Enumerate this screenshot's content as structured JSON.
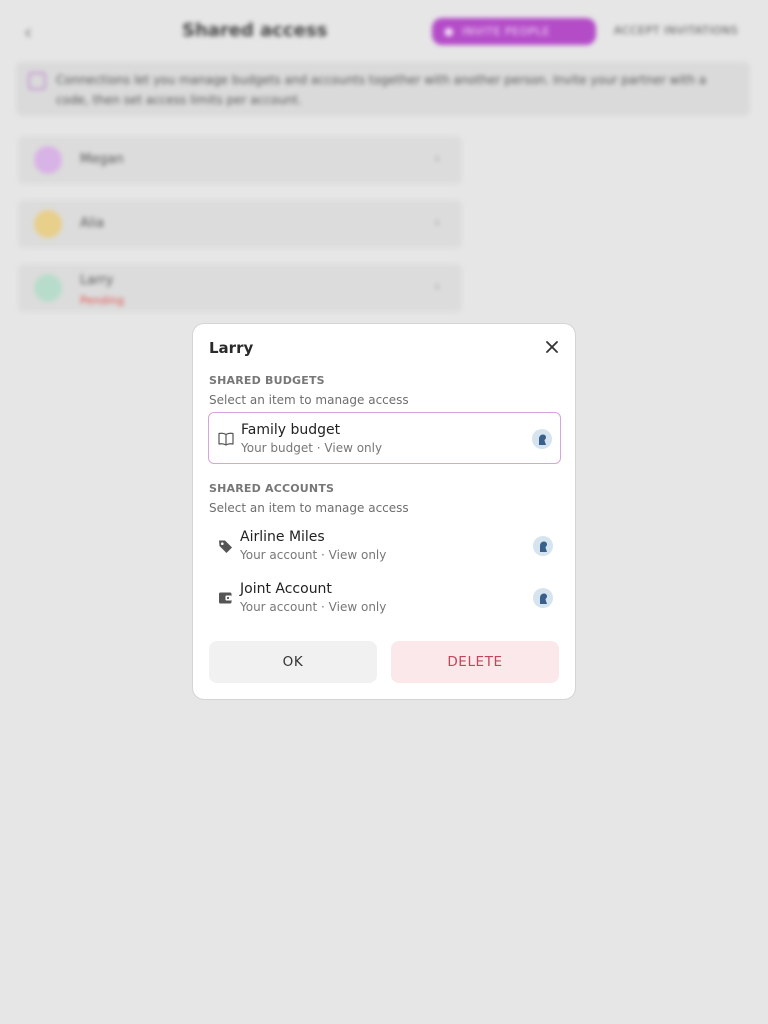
{
  "background": {
    "back_glyph": "‹",
    "title": "Shared access",
    "invite_label": "INVITE PEOPLE",
    "accept_label": "ACCEPT INVITATIONS",
    "info_text": "Connections let you manage budgets and accounts together with another person. Invite your partner with a code, then set access limits per account.",
    "people": [
      {
        "name": "Megan",
        "sub": "",
        "color": "#d8b3e6"
      },
      {
        "name": "Alia",
        "sub": "",
        "color": "#e8cf8a"
      },
      {
        "name": "Larry",
        "sub": "Pending",
        "color": "#b8dccb"
      }
    ]
  },
  "dialog": {
    "title": "Larry",
    "shared_budgets": {
      "heading": "SHARED BUDGETS",
      "hint": "Select an item to manage access",
      "items": [
        {
          "name": "Family budget",
          "sub": "Your budget · View only",
          "icon": "book-icon"
        }
      ]
    },
    "shared_accounts": {
      "heading": "SHARED ACCOUNTS",
      "hint": "Select an item to manage access",
      "items": [
        {
          "name": "Airline Miles",
          "sub": "Your account · View only",
          "icon": "tag-icon"
        },
        {
          "name": "Joint Account",
          "sub": "Your account · View only",
          "icon": "wallet-icon"
        }
      ]
    },
    "ok_label": "OK",
    "delete_label": "DELETE"
  },
  "colors": {
    "accent": "#b44cc8",
    "delete_text": "#c3455a",
    "delete_bg": "#fbe8ea",
    "selected_border": "#d9a3e3"
  }
}
